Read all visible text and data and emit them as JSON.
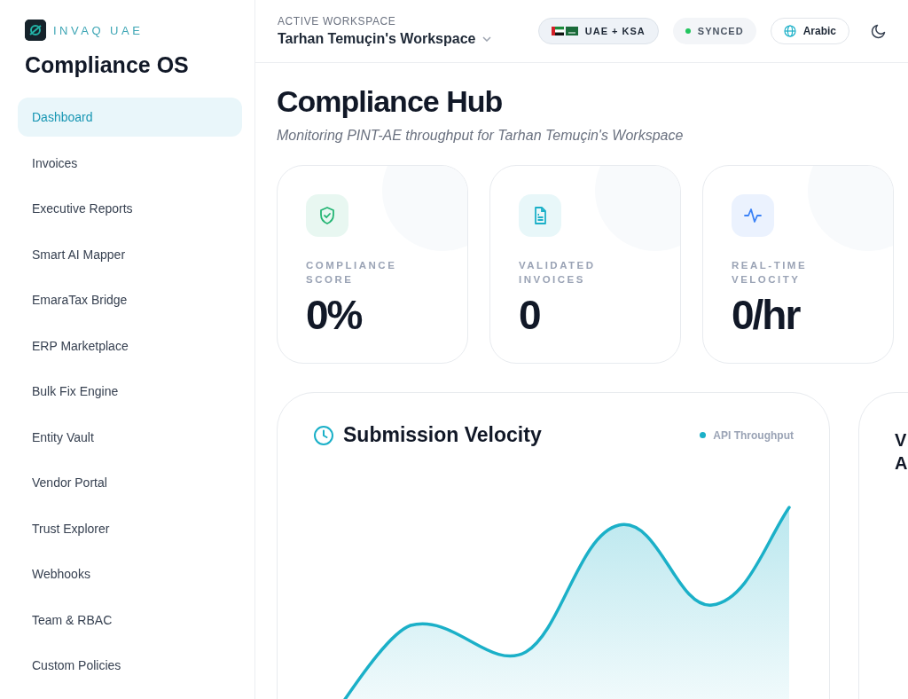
{
  "sidebar": {
    "brand": "INVAQ UAE",
    "title": "Compliance OS",
    "items": [
      {
        "label": "Dashboard",
        "selected": true
      },
      {
        "label": "Invoices",
        "selected": false
      },
      {
        "label": "Executive Reports",
        "selected": false
      },
      {
        "label": "Smart AI Mapper",
        "selected": false
      },
      {
        "label": "EmaraTax Bridge",
        "selected": false
      },
      {
        "label": "ERP Marketplace",
        "selected": false
      },
      {
        "label": "Bulk Fix Engine",
        "selected": false
      },
      {
        "label": "Entity Vault",
        "selected": false
      },
      {
        "label": "Vendor Portal",
        "selected": false
      },
      {
        "label": "Trust Explorer",
        "selected": false
      },
      {
        "label": "Webhooks",
        "selected": false
      },
      {
        "label": "Team & RBAC",
        "selected": false
      },
      {
        "label": "Custom Policies",
        "selected": false
      }
    ]
  },
  "header": {
    "workspace_label": "ACTIVE WORKSPACE",
    "workspace": "Tarhan Temuçin's Workspace",
    "region": "UAE + KSA",
    "sync_status": "SYNCED",
    "language": "Arabic"
  },
  "page": {
    "title": "Compliance Hub",
    "subtitle": "Monitoring PINT-AE throughput for Tarhan Temuçin's Workspace"
  },
  "stats": [
    {
      "kind": "shield",
      "label": "COMPLIANCE SCORE",
      "value": "0%",
      "color": "#22b573"
    },
    {
      "kind": "document",
      "label": "VALIDATED INVOICES",
      "value": "0",
      "color": "#1bb0c8"
    },
    {
      "kind": "pulse",
      "label": "REAL-TIME VELOCITY",
      "value": "0/hr",
      "color": "#3b82f6"
    }
  ],
  "velocity": {
    "title": "Submission Velocity",
    "legend": "API Throughput"
  },
  "side_card": {
    "title_lines": [
      "V",
      "A"
    ]
  }
}
